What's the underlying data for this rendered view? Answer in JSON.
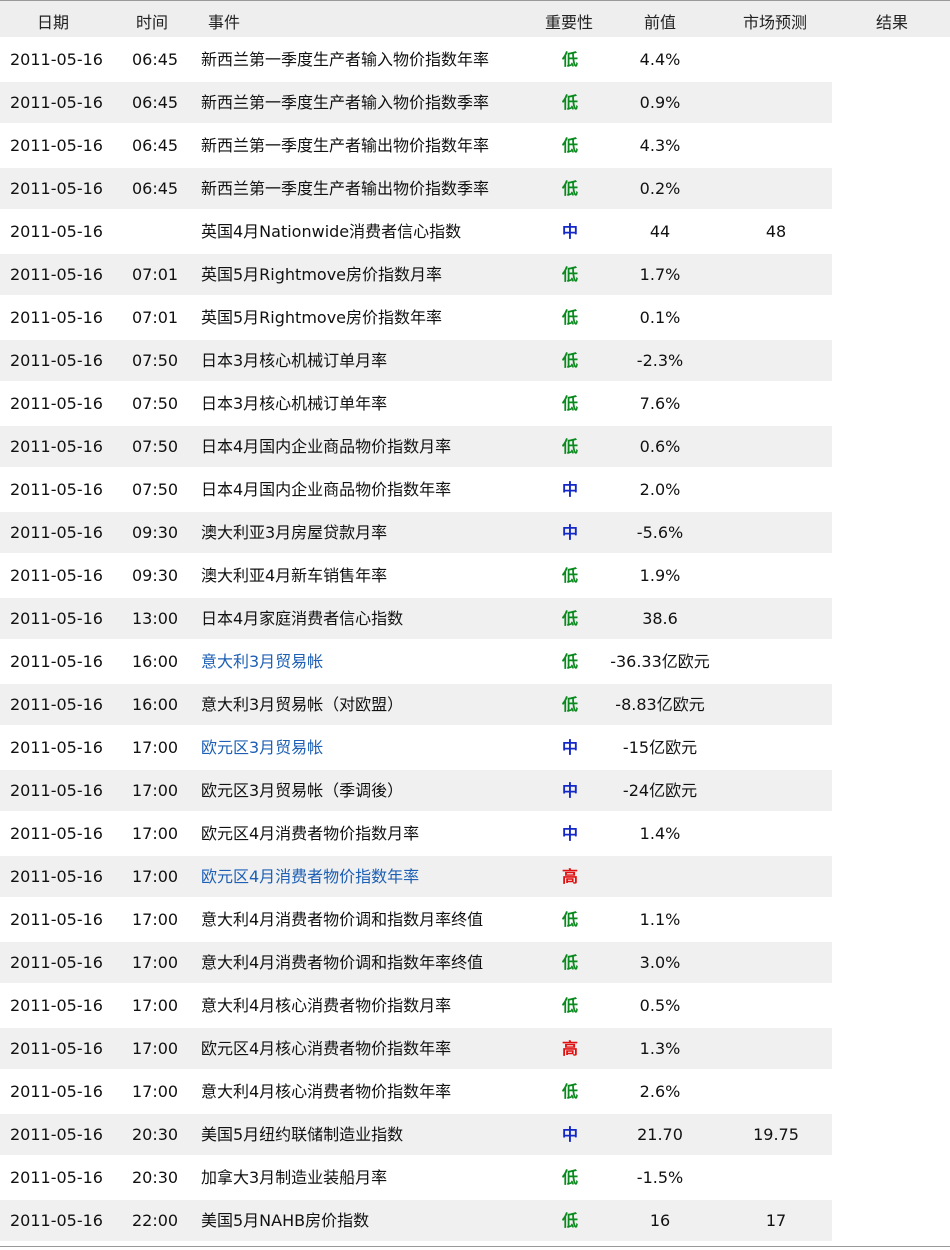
{
  "header": {
    "date": "日期",
    "time": "时间",
    "event": "事件",
    "importance": "重要性",
    "previous": "前值",
    "forecast": "市场预测",
    "result": "结果"
  },
  "colors": {
    "low": "#0a8a1e",
    "mid": "#1428c8",
    "high": "#e01010",
    "link": "#1d5fb4"
  },
  "rows": [
    {
      "date": "2011-05-16",
      "time": "06:45",
      "event": "新西兰第一季度生产者输入物价指数年率",
      "link": false,
      "importance": "低",
      "level": "low",
      "previous": "4.4%",
      "forecast": "",
      "result": ""
    },
    {
      "date": "2011-05-16",
      "time": "06:45",
      "event": "新西兰第一季度生产者输入物价指数季率",
      "link": false,
      "importance": "低",
      "level": "low",
      "previous": "0.9%",
      "forecast": "",
      "result": ""
    },
    {
      "date": "2011-05-16",
      "time": "06:45",
      "event": "新西兰第一季度生产者输出物价指数年率",
      "link": false,
      "importance": "低",
      "level": "low",
      "previous": "4.3%",
      "forecast": "",
      "result": ""
    },
    {
      "date": "2011-05-16",
      "time": "06:45",
      "event": "新西兰第一季度生产者输出物价指数季率",
      "link": false,
      "importance": "低",
      "level": "low",
      "previous": "0.2%",
      "forecast": "",
      "result": ""
    },
    {
      "date": "2011-05-16",
      "time": "",
      "event": "英国4月Nationwide消费者信心指数",
      "link": false,
      "importance": "中",
      "level": "mid",
      "previous": "44",
      "forecast": "48",
      "result": ""
    },
    {
      "date": "2011-05-16",
      "time": "07:01",
      "event": "英国5月Rightmove房价指数月率",
      "link": false,
      "importance": "低",
      "level": "low",
      "previous": "1.7%",
      "forecast": "",
      "result": ""
    },
    {
      "date": "2011-05-16",
      "time": "07:01",
      "event": "英国5月Rightmove房价指数年率",
      "link": false,
      "importance": "低",
      "level": "low",
      "previous": "0.1%",
      "forecast": "",
      "result": ""
    },
    {
      "date": "2011-05-16",
      "time": "07:50",
      "event": "日本3月核心机械订单月率",
      "link": false,
      "importance": "低",
      "level": "low",
      "previous": "-2.3%",
      "forecast": "",
      "result": ""
    },
    {
      "date": "2011-05-16",
      "time": "07:50",
      "event": "日本3月核心机械订单年率",
      "link": false,
      "importance": "低",
      "level": "low",
      "previous": "7.6%",
      "forecast": "",
      "result": ""
    },
    {
      "date": "2011-05-16",
      "time": "07:50",
      "event": "日本4月国内企业商品物价指数月率",
      "link": false,
      "importance": "低",
      "level": "low",
      "previous": "0.6%",
      "forecast": "",
      "result": ""
    },
    {
      "date": "2011-05-16",
      "time": "07:50",
      "event": "日本4月国内企业商品物价指数年率",
      "link": false,
      "importance": "中",
      "level": "mid",
      "previous": "2.0%",
      "forecast": "",
      "result": ""
    },
    {
      "date": "2011-05-16",
      "time": "09:30",
      "event": "澳大利亚3月房屋贷款月率",
      "link": false,
      "importance": "中",
      "level": "mid",
      "previous": "-5.6%",
      "forecast": "",
      "result": ""
    },
    {
      "date": "2011-05-16",
      "time": "09:30",
      "event": "澳大利亚4月新车销售年率",
      "link": false,
      "importance": "低",
      "level": "low",
      "previous": "1.9%",
      "forecast": "",
      "result": ""
    },
    {
      "date": "2011-05-16",
      "time": "13:00",
      "event": "日本4月家庭消费者信心指数",
      "link": false,
      "importance": "低",
      "level": "low",
      "previous": "38.6",
      "forecast": "",
      "result": ""
    },
    {
      "date": "2011-05-16",
      "time": "16:00",
      "event": "意大利3月贸易帐",
      "link": true,
      "importance": "低",
      "level": "low",
      "previous": "-36.33亿欧元",
      "forecast": "",
      "result": ""
    },
    {
      "date": "2011-05-16",
      "time": "16:00",
      "event": "意大利3月贸易帐（对欧盟）",
      "link": false,
      "importance": "低",
      "level": "low",
      "previous": "-8.83亿欧元",
      "forecast": "",
      "result": ""
    },
    {
      "date": "2011-05-16",
      "time": "17:00",
      "event": "欧元区3月贸易帐",
      "link": true,
      "importance": "中",
      "level": "mid",
      "previous": "-15亿欧元",
      "forecast": "",
      "result": ""
    },
    {
      "date": "2011-05-16",
      "time": "17:00",
      "event": "欧元区3月贸易帐（季调後）",
      "link": false,
      "importance": "中",
      "level": "mid",
      "previous": "-24亿欧元",
      "forecast": "",
      "result": ""
    },
    {
      "date": "2011-05-16",
      "time": "17:00",
      "event": "欧元区4月消费者物价指数月率",
      "link": false,
      "importance": "中",
      "level": "mid",
      "previous": "1.4%",
      "forecast": "",
      "result": ""
    },
    {
      "date": "2011-05-16",
      "time": "17:00",
      "event": "欧元区4月消费者物价指数年率",
      "link": true,
      "importance": "高",
      "level": "high",
      "previous": "",
      "forecast": "",
      "result": ""
    },
    {
      "date": "2011-05-16",
      "time": "17:00",
      "event": "意大利4月消费者物价调和指数月率终值",
      "link": false,
      "importance": "低",
      "level": "low",
      "previous": "1.1%",
      "forecast": "",
      "result": ""
    },
    {
      "date": "2011-05-16",
      "time": "17:00",
      "event": "意大利4月消费者物价调和指数年率终值",
      "link": false,
      "importance": "低",
      "level": "low",
      "previous": "3.0%",
      "forecast": "",
      "result": ""
    },
    {
      "date": "2011-05-16",
      "time": "17:00",
      "event": "意大利4月核心消费者物价指数月率",
      "link": false,
      "importance": "低",
      "level": "low",
      "previous": "0.5%",
      "forecast": "",
      "result": ""
    },
    {
      "date": "2011-05-16",
      "time": "17:00",
      "event": "欧元区4月核心消费者物价指数年率",
      "link": false,
      "importance": "高",
      "level": "high",
      "previous": "1.3%",
      "forecast": "",
      "result": ""
    },
    {
      "date": "2011-05-16",
      "time": "17:00",
      "event": "意大利4月核心消费者物价指数年率",
      "link": false,
      "importance": "低",
      "level": "low",
      "previous": "2.6%",
      "forecast": "",
      "result": ""
    },
    {
      "date": "2011-05-16",
      "time": "20:30",
      "event": "美国5月纽约联储制造业指数",
      "link": false,
      "importance": "中",
      "level": "mid",
      "previous": "21.70",
      "forecast": "19.75",
      "result": ""
    },
    {
      "date": "2011-05-16",
      "time": "20:30",
      "event": "加拿大3月制造业装船月率",
      "link": false,
      "importance": "低",
      "level": "low",
      "previous": "-1.5%",
      "forecast": "",
      "result": ""
    },
    {
      "date": "2011-05-16",
      "time": "22:00",
      "event": "美国5月NAHB房价指数",
      "link": false,
      "importance": "低",
      "level": "low",
      "previous": "16",
      "forecast": "17",
      "result": ""
    }
  ]
}
